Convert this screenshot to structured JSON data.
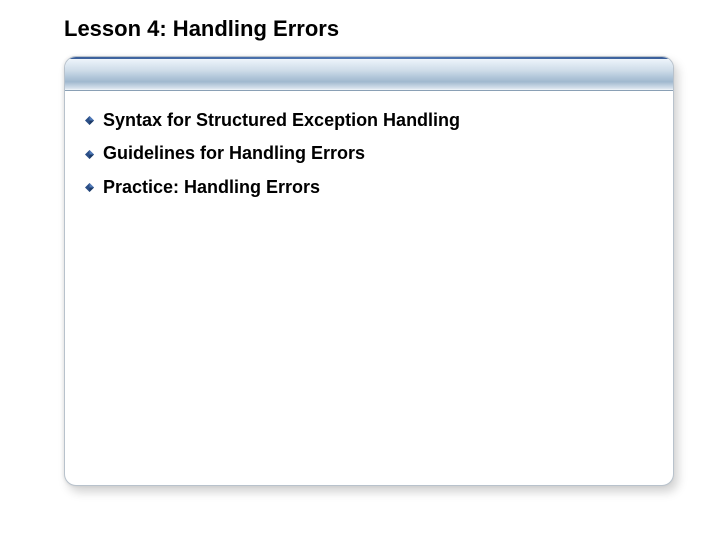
{
  "title": "Lesson 4: Handling Errors",
  "bullets": [
    {
      "label": "Syntax for Structured Exception Handling"
    },
    {
      "label": "Guidelines for Handling Errors"
    },
    {
      "label": "Practice: Handling Errors"
    }
  ]
}
